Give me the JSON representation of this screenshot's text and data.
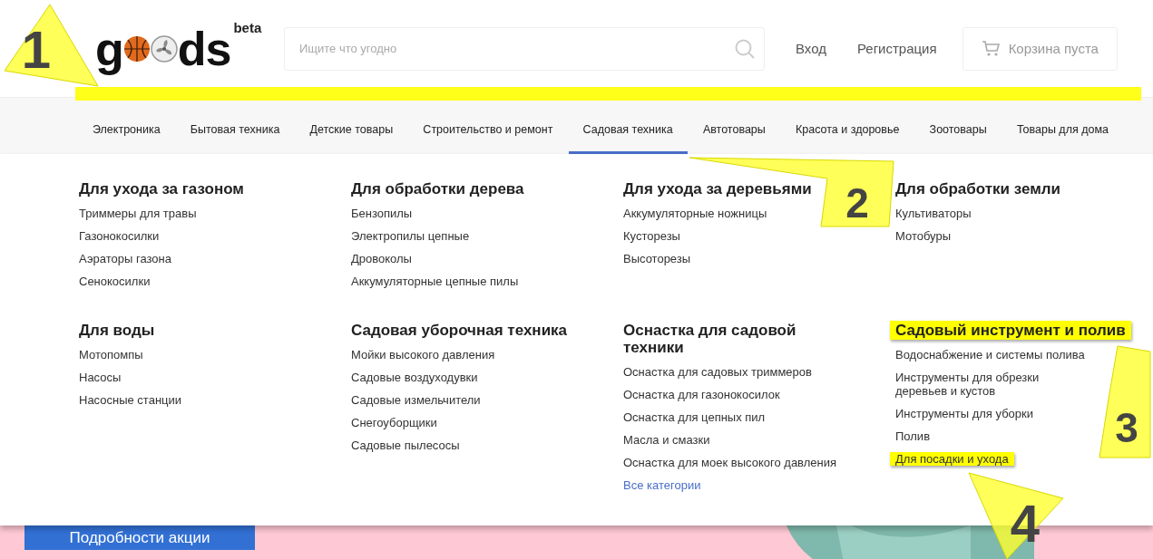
{
  "logo": {
    "start": "g",
    "end": "ds",
    "badge": "beta"
  },
  "search": {
    "placeholder": "Ищите что угодно"
  },
  "account_links": [
    "Вход",
    "Регистрация"
  ],
  "cart": {
    "label": "Корзина пуста"
  },
  "nav": [
    {
      "label": "Электроника",
      "selected": false
    },
    {
      "label": "Бытовая техника",
      "selected": false
    },
    {
      "label": "Детские товары",
      "selected": false
    },
    {
      "label": "Строительство и ремонт",
      "selected": false
    },
    {
      "label": "Садовая техника",
      "selected": true
    },
    {
      "label": "Автотовары",
      "selected": false
    },
    {
      "label": "Красота и здоровье",
      "selected": false
    },
    {
      "label": "Зоотовары",
      "selected": false
    },
    {
      "label": "Товары для дома",
      "selected": false
    }
  ],
  "menu_groups": [
    {
      "title": "Для ухода за газоном",
      "highlighted": false,
      "items": [
        {
          "label": "Триммеры для травы",
          "highlighted": false
        },
        {
          "label": "Газонокосилки",
          "highlighted": false
        },
        {
          "label": "Аэраторы газона",
          "highlighted": false
        },
        {
          "label": "Сенокосилки",
          "highlighted": false
        }
      ]
    },
    {
      "title": "Для обработки дерева",
      "highlighted": false,
      "items": [
        {
          "label": "Бензопилы",
          "highlighted": false
        },
        {
          "label": "Электропилы цепные",
          "highlighted": false
        },
        {
          "label": "Дровоколы",
          "highlighted": false
        },
        {
          "label": "Аккумуляторные цепные пилы",
          "highlighted": false
        }
      ]
    },
    {
      "title": "Для ухода за деревьями",
      "highlighted": false,
      "items": [
        {
          "label": "Аккумуляторные ножницы",
          "highlighted": false
        },
        {
          "label": "Кусторезы",
          "highlighted": false
        },
        {
          "label": "Высоторезы",
          "highlighted": false
        }
      ]
    },
    {
      "title": "Для обработки земли",
      "highlighted": false,
      "items": [
        {
          "label": "Культиваторы",
          "highlighted": false
        },
        {
          "label": "Мотобуры",
          "highlighted": false
        }
      ]
    },
    {
      "title": "Для воды",
      "highlighted": false,
      "items": [
        {
          "label": "Мотопомпы",
          "highlighted": false
        },
        {
          "label": "Насосы",
          "highlighted": false
        },
        {
          "label": "Насосные станции",
          "highlighted": false
        }
      ]
    },
    {
      "title": "Садовая уборочная техника",
      "highlighted": false,
      "items": [
        {
          "label": "Мойки высокого давления",
          "highlighted": false
        },
        {
          "label": "Садовые воздуходувки",
          "highlighted": false
        },
        {
          "label": "Садовые измельчители",
          "highlighted": false
        },
        {
          "label": "Снегоуборщики",
          "highlighted": false
        },
        {
          "label": "Садовые пылесосы",
          "highlighted": false
        }
      ]
    },
    {
      "title": "Оснастка для садовой техники",
      "highlighted": false,
      "items": [
        {
          "label": "Оснастка для садовых триммеров",
          "highlighted": false
        },
        {
          "label": "Оснастка для газонокосилок",
          "highlighted": false
        },
        {
          "label": "Оснастка для цепных пил",
          "highlighted": false
        },
        {
          "label": "Масла и смазки",
          "highlighted": false
        },
        {
          "label": "Оснастка для моек высокого давления",
          "highlighted": false
        }
      ],
      "more_link": "Все категории"
    },
    {
      "title": "Садовый инструмент и полив",
      "highlighted": true,
      "items": [
        {
          "label": "Водоснабжение и системы полива",
          "highlighted": false
        },
        {
          "label": "Инструменты для обрезки деревьев и кустов",
          "highlighted": false
        },
        {
          "label": "Инструменты для уборки",
          "highlighted": false
        },
        {
          "label": "Полив",
          "highlighted": false
        },
        {
          "label": "Для посадки и ухода",
          "highlighted": true
        }
      ]
    }
  ],
  "promo": {
    "button": "Подробности акции"
  },
  "annotations": [
    {
      "number": "1"
    },
    {
      "number": "2"
    },
    {
      "number": "3"
    },
    {
      "number": "4"
    }
  ]
}
